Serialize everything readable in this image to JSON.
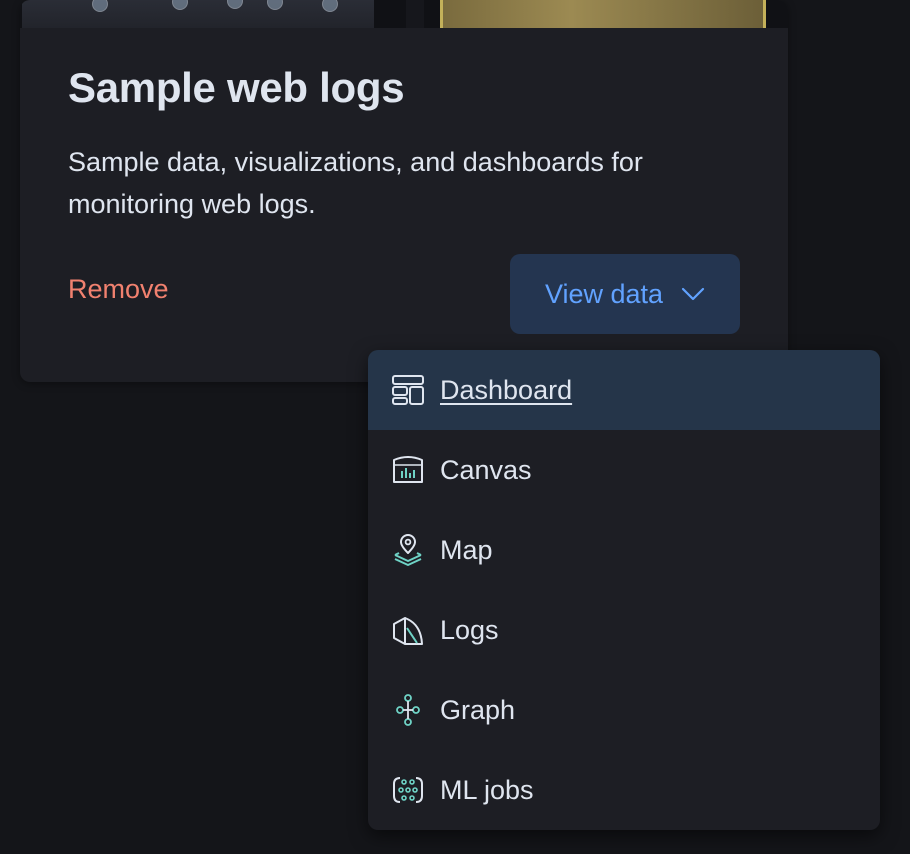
{
  "card": {
    "title": "Sample web logs",
    "description": "Sample data, visualizations, and dashboards for monitoring web logs.",
    "remove_label": "Remove",
    "view_data_label": "View data"
  },
  "menu": {
    "items": [
      {
        "label": "Dashboard",
        "icon": "dashboard-icon",
        "active": true
      },
      {
        "label": "Canvas",
        "icon": "canvas-icon",
        "active": false
      },
      {
        "label": "Map",
        "icon": "map-icon",
        "active": false
      },
      {
        "label": "Logs",
        "icon": "logs-icon",
        "active": false
      },
      {
        "label": "Graph",
        "icon": "graph-icon",
        "active": false
      },
      {
        "label": "ML jobs",
        "icon": "ml-jobs-icon",
        "active": false
      }
    ]
  },
  "colors": {
    "background": "#141519",
    "card": "#1d1e24",
    "text": "#dfe5ef",
    "danger": "#f1816f",
    "primary": "#61a2ff",
    "primary_bg": "#243550",
    "menu_active_bg": "#253549",
    "icon_accent": "#6fd3c6"
  }
}
